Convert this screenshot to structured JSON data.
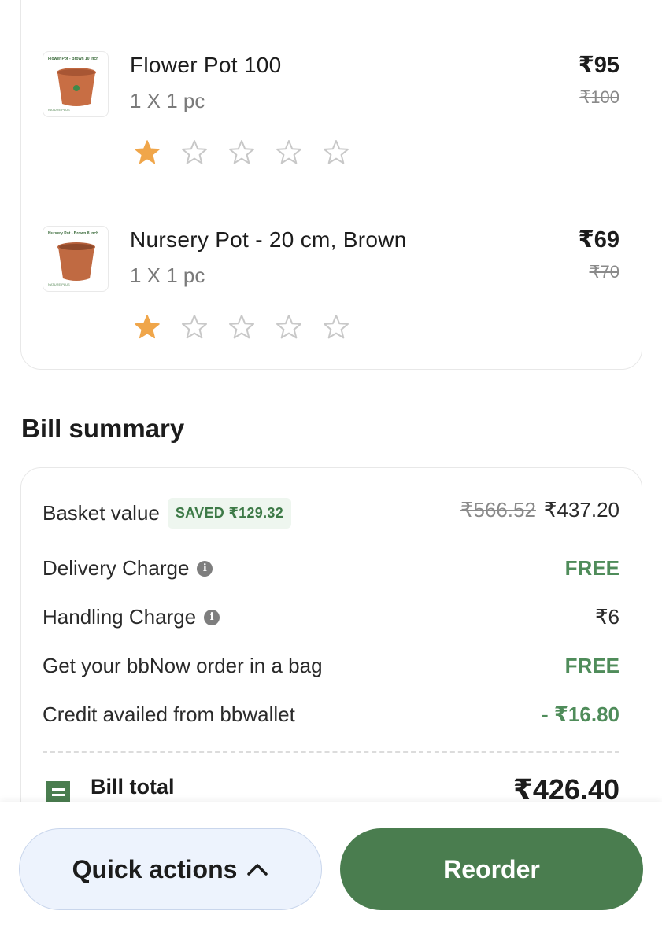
{
  "items": [
    {
      "name": "Flower Pot 100",
      "qty": "1 X 1 pc",
      "price": "₹95",
      "mrp": "₹100",
      "thumb_label": "Flower Pot - Brown 10 inch",
      "thumb_brand": "NATURE PLUS",
      "rating": 1,
      "rating_max": 5
    },
    {
      "name": "Nursery Pot - 20 cm, Brown",
      "qty": "1 X 1 pc",
      "price": "₹69",
      "mrp": "₹70",
      "thumb_label": "Nursery Pot - Brown 8 inch",
      "thumb_brand": "NATURE PLUS",
      "rating": 1,
      "rating_max": 5
    }
  ],
  "bill": {
    "title": "Bill summary",
    "basket_label": "Basket value",
    "saved_badge": "SAVED ₹129.32",
    "basket_mrp": "₹566.52",
    "basket_value": "₹437.20",
    "delivery_label": "Delivery Charge",
    "delivery_value": "FREE",
    "handling_label": "Handling Charge",
    "handling_value": "₹6",
    "bag_label": "Get your bbNow order in a bag",
    "bag_value": "FREE",
    "wallet_label": "Credit availed from bbwallet",
    "wallet_value": "- ₹16.80",
    "total_label": "Bill total",
    "total_value": "₹426.40"
  },
  "actions": {
    "quick_label": "Quick actions",
    "reorder_label": "Reorder"
  },
  "colors": {
    "accent_green": "#4a7d4f",
    "star_filled": "#f0a64a",
    "star_empty": "#c8c8c8"
  },
  "icons": {
    "info": "info-icon",
    "receipt": "receipt-icon",
    "chevron": "chevron-up-icon"
  }
}
